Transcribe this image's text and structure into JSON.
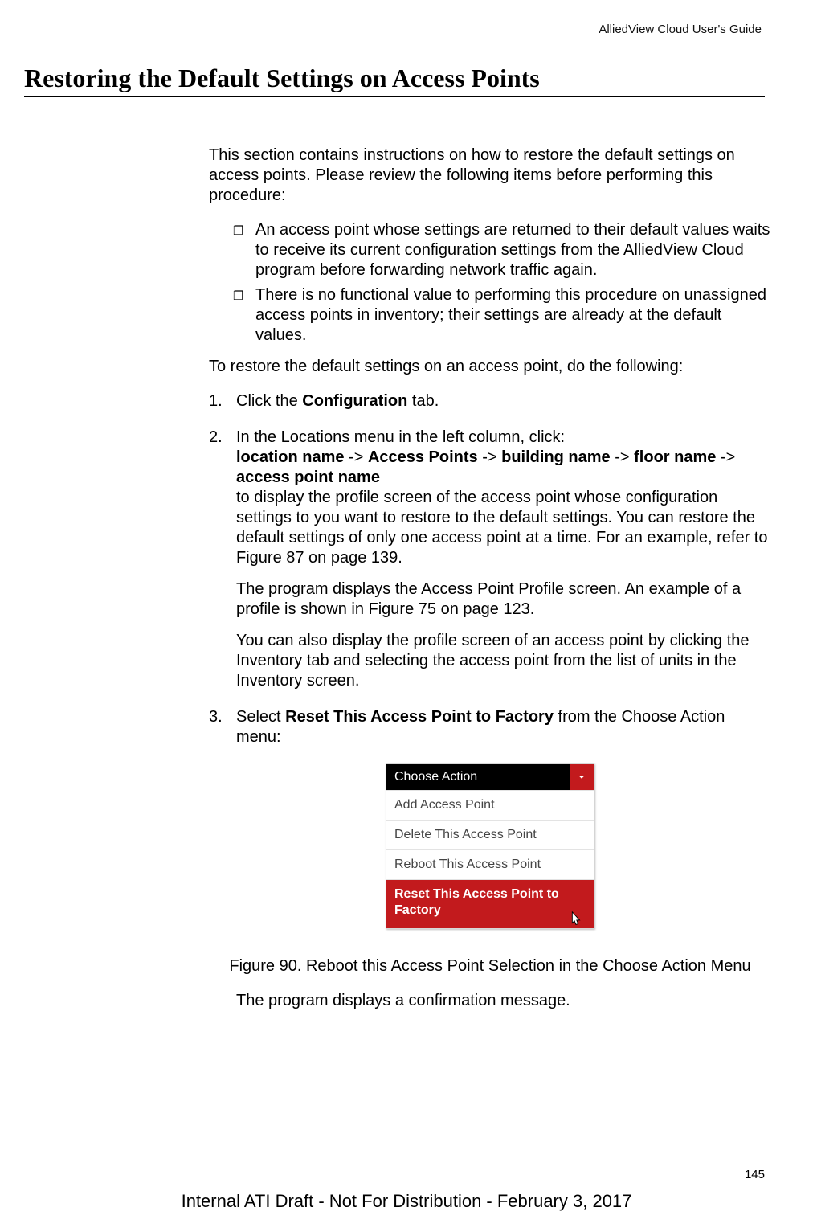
{
  "header": {
    "document_title": "AlliedView Cloud User's Guide"
  },
  "title": "Restoring the Default Settings on Access Points",
  "intro": "This section contains instructions on how to restore the default settings on access points. Please review the following items before performing this procedure:",
  "bullets": [
    "An access point whose settings are returned to their default values waits to receive its current configuration settings from the AlliedView Cloud program before forwarding network traffic again.",
    "There is no functional value to performing this procedure on unassigned access points in inventory; their settings are already at the default values."
  ],
  "lead": "To restore the default settings on an access point, do the following:",
  "steps": {
    "s1_pre": "Click the ",
    "s1_bold": "Configuration",
    "s1_post": " tab.",
    "s2_line1": "In the Locations menu in the left column, click:",
    "s2_path_location": "location name",
    "s2_path_ap": "Access Points",
    "s2_path_building": "building name",
    "s2_path_floor": "floor name",
    "s2_path_apname": "access point name",
    "s2_arrow": " -> ",
    "s2_post": "to display the profile screen of the access point whose configuration settings to you want to restore to the default settings. You can restore the default settings of only one access point at a time. For an example, refer to Figure 87 on page 139.",
    "s2_p2": "The program displays the Access Point Profile screen. An example of a profile is shown in Figure 75 on page 123.",
    "s2_p3": "You can also display the profile screen of an access point by clicking the Inventory tab and selecting the access point from the list of units in the Inventory screen.",
    "s3_pre": "Select ",
    "s3_bold": "Reset This Access Point to Factory",
    "s3_post": " from the Choose Action menu:"
  },
  "menu": {
    "header": "Choose Action",
    "items": [
      "Add Access Point",
      "Delete This Access Point",
      "Reboot This Access Point",
      "Reset This Access Point to Factory"
    ]
  },
  "figure_caption": "Figure 90. Reboot this Access Point Selection in the Choose Action Menu",
  "after_figure": "The program displays a confirmation message.",
  "page_number": "145",
  "footer": "Internal ATI Draft - Not For Distribution - February 3, 2017"
}
